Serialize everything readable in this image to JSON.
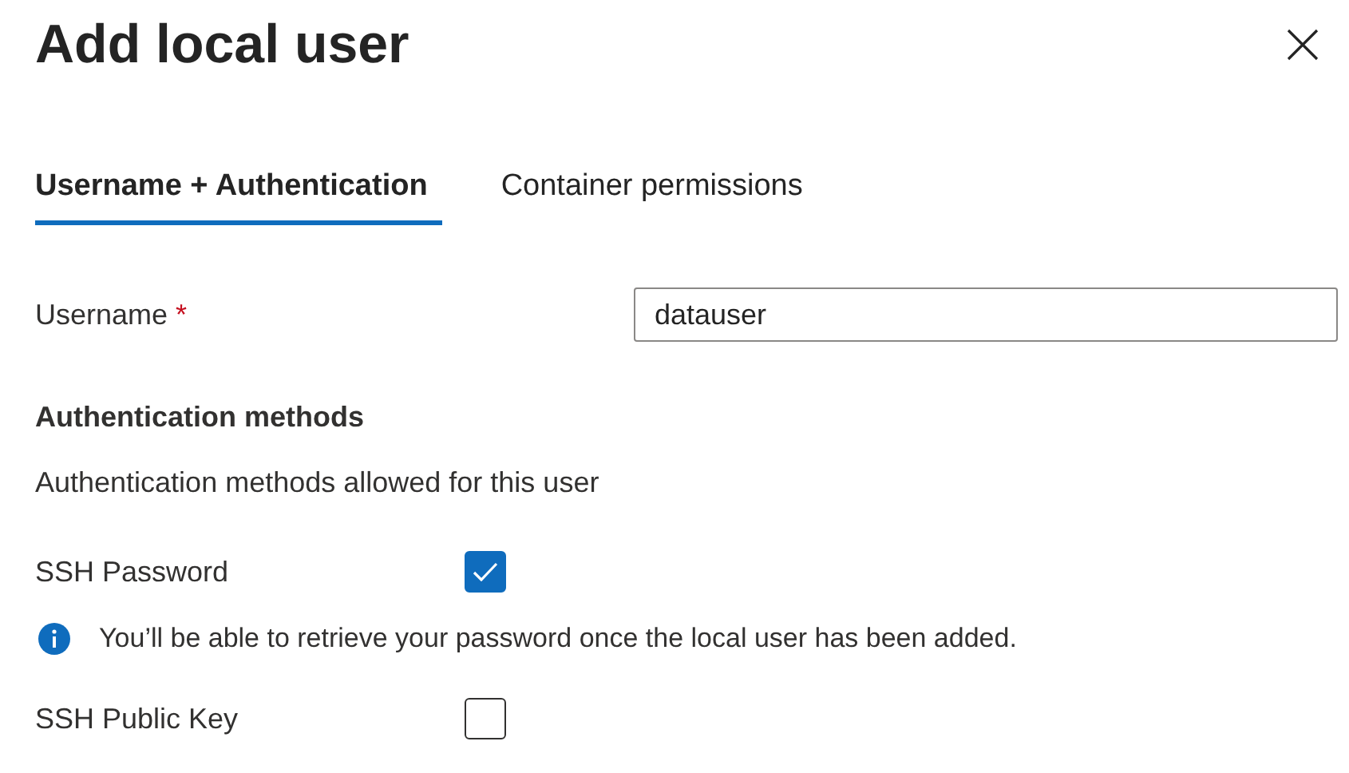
{
  "dialog": {
    "title": "Add local user"
  },
  "tabs": [
    {
      "label": "Username + Authentication",
      "selected": true
    },
    {
      "label": "Container permissions",
      "selected": false
    }
  ],
  "username": {
    "label": "Username",
    "required_mark": "*",
    "value": "datauser"
  },
  "authentication": {
    "heading": "Authentication methods",
    "description": "Authentication methods allowed for this user",
    "methods": [
      {
        "label": "SSH Password",
        "checked": true,
        "note": "You’ll be able to retrieve your password once the local user has been added."
      },
      {
        "label": "SSH Public Key",
        "checked": false
      }
    ]
  }
}
